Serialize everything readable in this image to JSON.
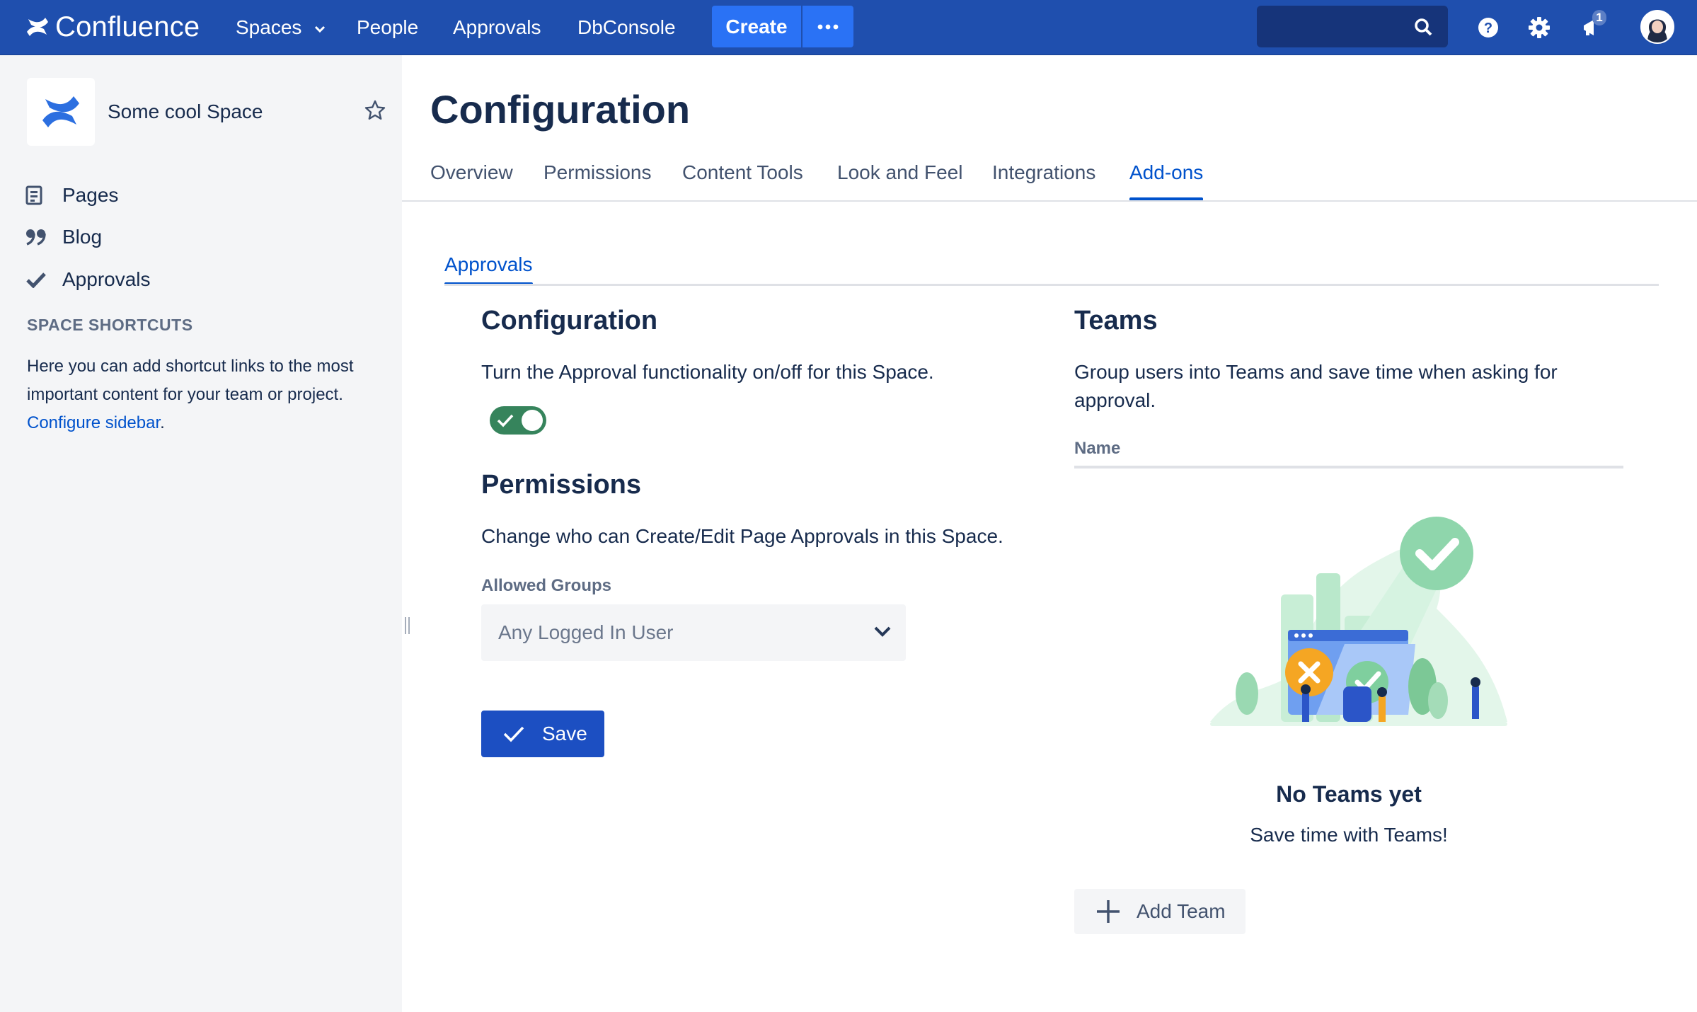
{
  "topnav": {
    "brand": "Confluence",
    "items": [
      {
        "label": "Spaces"
      },
      {
        "label": "People"
      },
      {
        "label": "Approvals"
      },
      {
        "label": "DbConsole"
      }
    ],
    "create_label": "Create",
    "search_placeholder": "",
    "notification_count": "1",
    "colors": {
      "bar": "#1f4fae",
      "create": "#2a72f5"
    }
  },
  "sidebar": {
    "space_name": "Some cool Space",
    "items": [
      {
        "label": "Pages",
        "icon": "page-icon"
      },
      {
        "label": "Blog",
        "icon": "quote-icon"
      },
      {
        "label": "Approvals",
        "icon": "checkmark-icon"
      }
    ],
    "shortcuts_heading": "SPACE SHORTCUTS",
    "shortcuts_text": "Here you can add shortcut links to the most important content for your team or project.",
    "configure_link": "Configure sidebar",
    "shortcuts_suffix": "."
  },
  "main": {
    "title": "Configuration",
    "tabs": [
      {
        "label": "Overview"
      },
      {
        "label": "Permissions"
      },
      {
        "label": "Content Tools"
      },
      {
        "label": "Look and Feel"
      },
      {
        "label": "Integrations"
      },
      {
        "label": "Add-ons",
        "active": true
      }
    ],
    "subtab": "Approvals",
    "config": {
      "heading": "Configuration",
      "text": "Turn the Approval functionality on/off for this Space.",
      "toggle_on": true
    },
    "permissions": {
      "heading": "Permissions",
      "text": "Change who can Create/Edit Page Approvals in this Space.",
      "allowed_groups_label": "Allowed Groups",
      "allowed_groups_value": "Any Logged In User"
    },
    "save_label": "Save",
    "teams": {
      "heading": "Teams",
      "text": "Group users into Teams and save time when asking for approval.",
      "column_name": "Name",
      "empty_title": "No Teams yet",
      "empty_subtitle": "Save time with Teams!",
      "add_label": "Add Team"
    }
  }
}
